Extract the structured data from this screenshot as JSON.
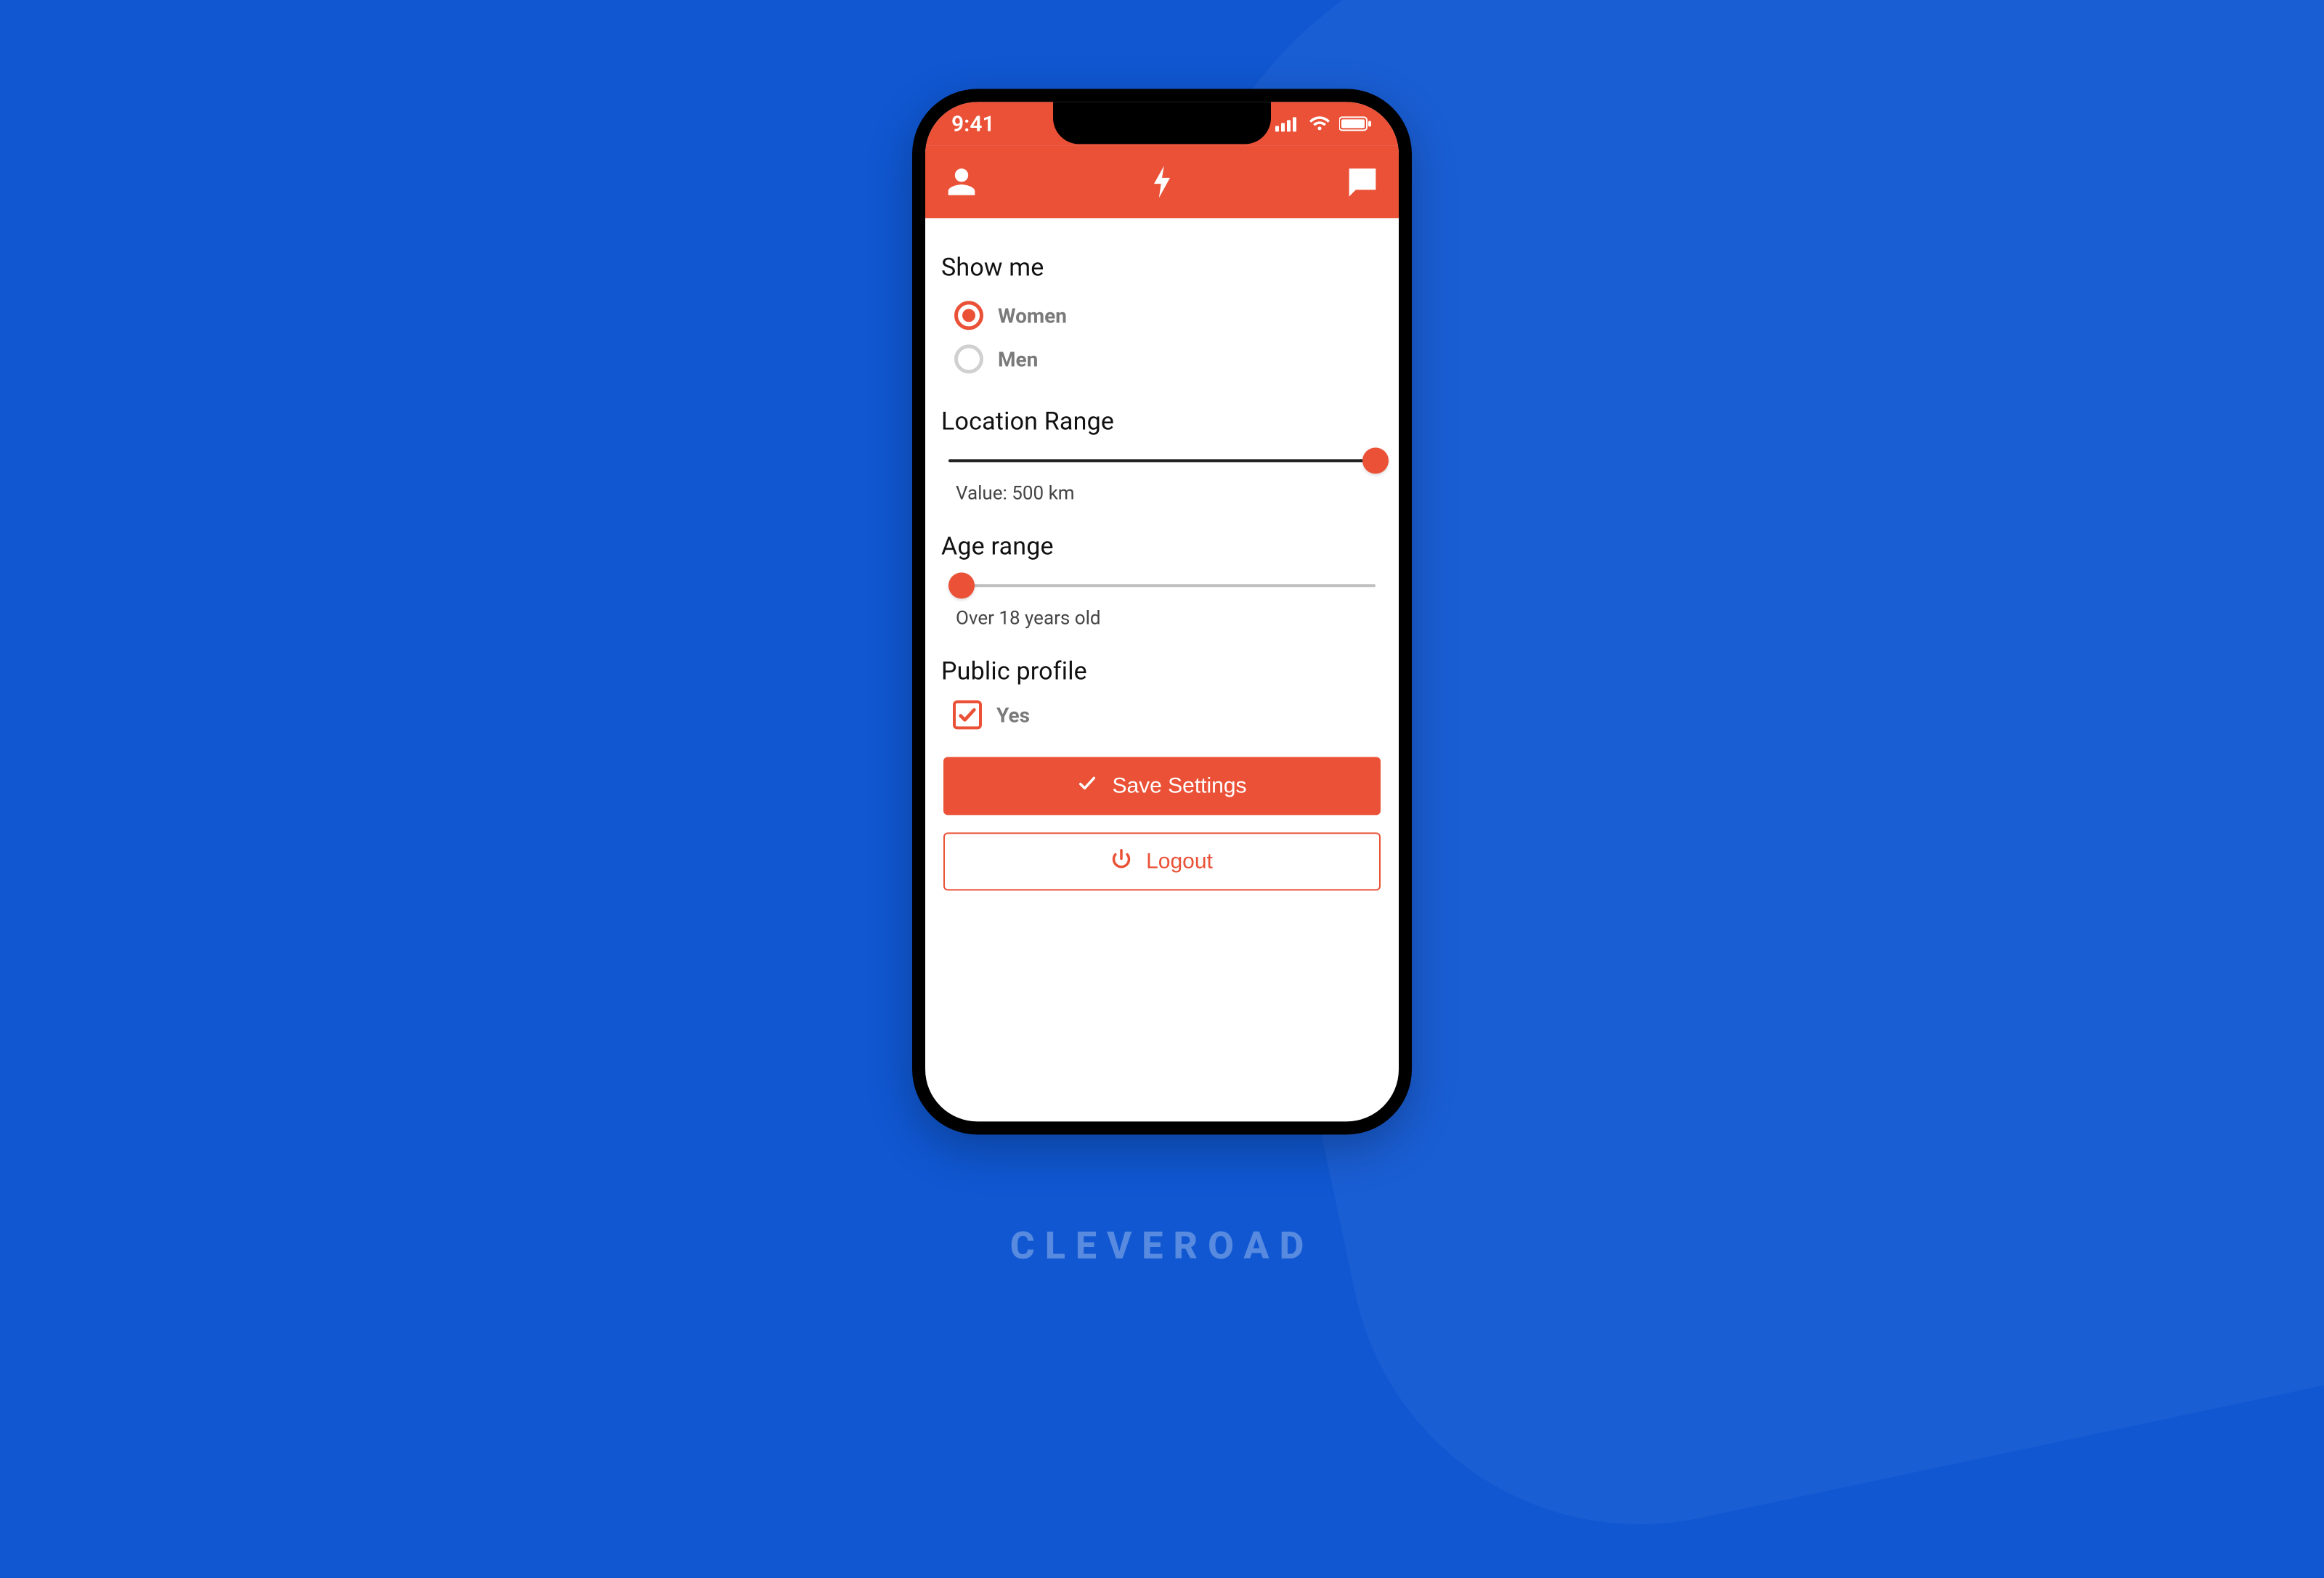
{
  "status_bar": {
    "time": "9:41"
  },
  "settings": {
    "show_me": {
      "title": "Show me",
      "options": [
        {
          "label": "Women",
          "selected": true
        },
        {
          "label": "Men",
          "selected": false
        }
      ]
    },
    "location_range": {
      "title": "Location Range",
      "value_label": "Value: 500 km",
      "percent": 100
    },
    "age_range": {
      "title": "Age range",
      "value_label": "Over 18 years old",
      "percent": 0
    },
    "public_profile": {
      "title": "Public profile",
      "option_label": "Yes",
      "checked": true
    }
  },
  "buttons": {
    "save": "Save Settings",
    "logout": "Logout"
  },
  "brand": "CLEVEROAD",
  "colors": {
    "accent": "#ea5137",
    "bg": "#1057d1"
  }
}
